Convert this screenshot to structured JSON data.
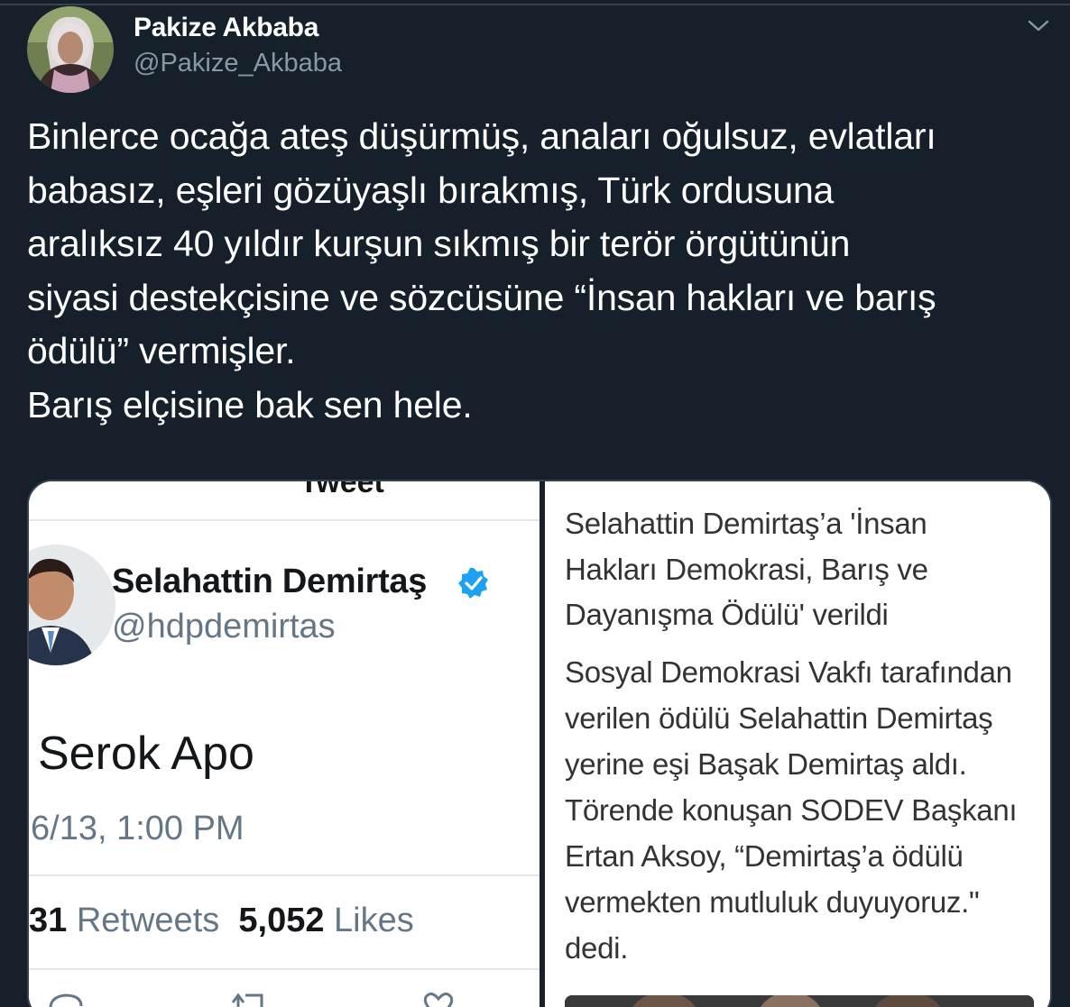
{
  "tweet": {
    "author": {
      "display_name": "Pakize Akbaba",
      "handle": "@Pakize_Akbaba"
    },
    "text_lines": [
      "Binlerce ocağa ateş düşürmüş, anaları oğulsuz, evlatları",
      "babasız, eşleri gözüyaşlı bırakmış, Türk ordusuna",
      "aralıksız 40 yıldır kurşun sıkmış bir terör örgütünün",
      "siyasi destekçisine ve sözcüsüne “İnsan hakları ve barış",
      "ödülü” vermişler.",
      "Barış elçisine bak sen hele."
    ],
    "icons": {
      "menu": "chevron-down-icon"
    }
  },
  "media": {
    "left_screenshot": {
      "header_fragment": "Tweet",
      "author_name": "Selahattin Demirtaş",
      "author_handle": "@hdpdemirtas",
      "text": "Serok Apo",
      "timestamp": "6/13, 1:00 PM",
      "retweets_count": "31",
      "retweets_label": "Retweets",
      "likes_count": "5,052",
      "likes_label": "Likes",
      "icons": [
        "verified-badge-icon",
        "reply-icon",
        "retweet-icon",
        "like-icon"
      ]
    },
    "right_screenshot": {
      "headline_lines": [
        "Selahattin Demirtaş’a 'İnsan",
        "Hakları Demokrasi, Barış ve",
        "Dayanışma Ödülü' verildi"
      ],
      "body_lines": [
        "Sosyal Demokrasi Vakfı tarafından",
        "verilen ödülü Selahattin Demirtaş",
        "yerine eşi Başak Demirtaş aldı.",
        "Törende konuşan SODEV Başkanı",
        "Ertan Aksoy, “Demirtaş’a ödülü",
        "vermekten mutluluk duyuyoruz.\"",
        "dedi."
      ]
    }
  },
  "colors": {
    "background": "#15202b",
    "secondary_text": "#8899a6",
    "border": "#38444d",
    "verified_blue": "#1da1f2"
  }
}
